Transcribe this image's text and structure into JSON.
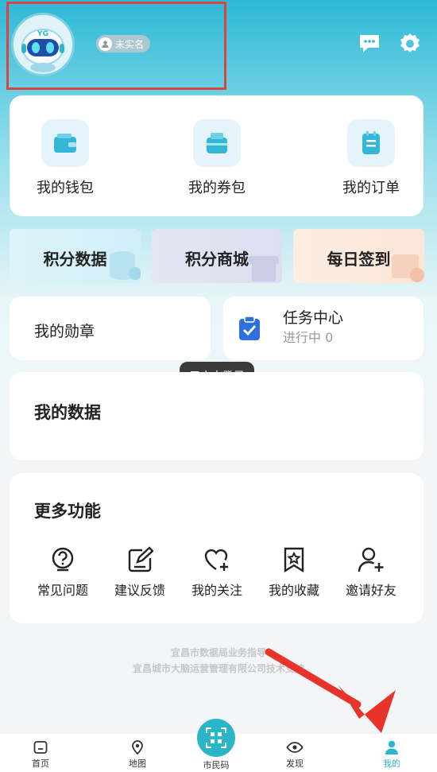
{
  "header": {
    "auth_badge": "未实名",
    "avatar_mark": "YG",
    "colors": {
      "accent": "#2bb5d0",
      "highlight_box": "#d9453c",
      "arrow": "#e8332b"
    }
  },
  "wallet_row": [
    {
      "label": "我的钱包",
      "icon": "wallet-icon"
    },
    {
      "label": "我的券包",
      "icon": "coupon-icon"
    },
    {
      "label": "我的订单",
      "icon": "order-icon"
    }
  ],
  "points_row": [
    {
      "label": "积分数据",
      "icon": "database-icon"
    },
    {
      "label": "积分商城",
      "icon": "store-icon"
    },
    {
      "label": "每日签到",
      "icon": "calendar-check-icon"
    }
  ],
  "badges": {
    "label": "我的勋章"
  },
  "tasks": {
    "title": "任务中心",
    "subtitle": "进行中 0",
    "icon": "clipboard-check-icon"
  },
  "toast": "用户未登录",
  "my_data": {
    "title": "我的数据"
  },
  "more": {
    "title": "更多功能",
    "items": [
      {
        "label": "常见问题",
        "icon": "question-icon"
      },
      {
        "label": "建议反馈",
        "icon": "feedback-icon"
      },
      {
        "label": "我的关注",
        "icon": "heart-plus-icon"
      },
      {
        "label": "我的收藏",
        "icon": "bookmark-star-icon"
      },
      {
        "label": "邀请好友",
        "icon": "user-add-icon"
      }
    ]
  },
  "footer": {
    "line1": "宜昌市数据局业务指导",
    "line2": "宜昌城市大脑运营管理有限公司技术支持"
  },
  "tabbar": [
    {
      "label": "首页",
      "icon": "home-icon"
    },
    {
      "label": "地图",
      "icon": "map-pin-icon"
    },
    {
      "label": "市民码",
      "icon": "qr-code-icon"
    },
    {
      "label": "发现",
      "icon": "eye-icon"
    },
    {
      "label": "我的",
      "icon": "person-icon",
      "active": true
    }
  ]
}
